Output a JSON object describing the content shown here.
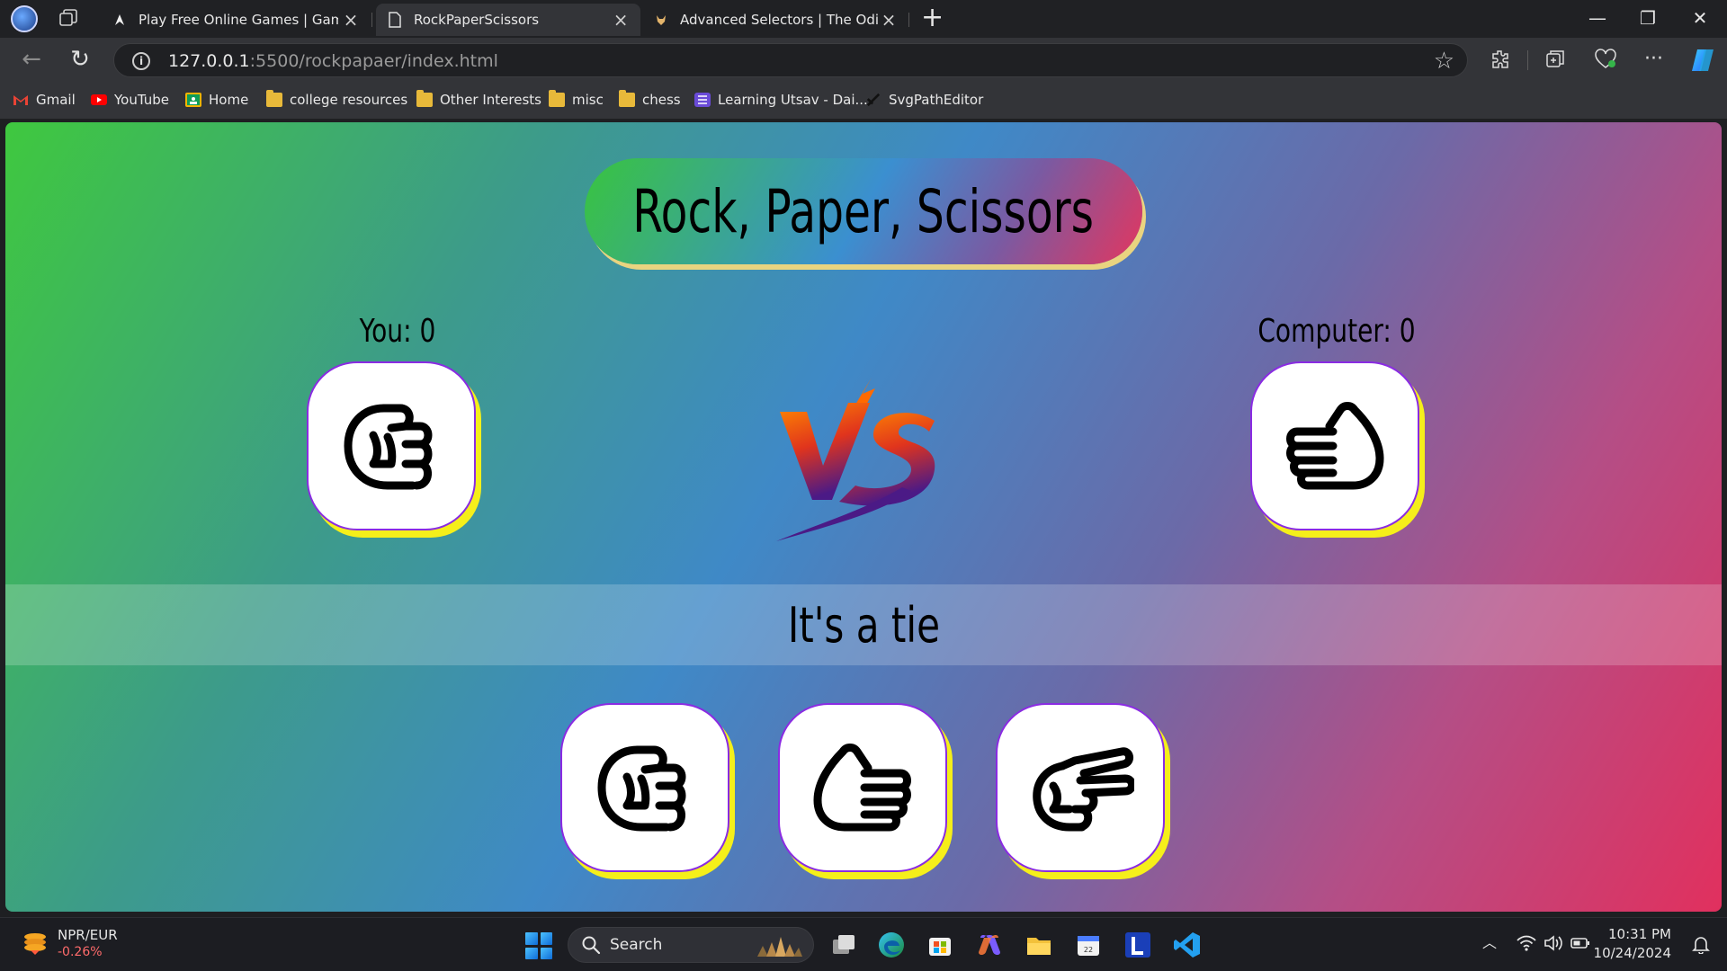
{
  "browser": {
    "tabs": [
      {
        "title": "Play Free Online Games | Games f",
        "active": false
      },
      {
        "title": "RockPaperScissors",
        "active": true
      },
      {
        "title": "Advanced Selectors | The Odin Pr",
        "active": false
      }
    ],
    "address": {
      "host": "127.0.0.1",
      "path": ":5500/rockpapaer/index.html"
    },
    "bookmarks": [
      "Gmail",
      "YouTube",
      "Home",
      "college resources",
      "Other Interests",
      "misc",
      "chess",
      "Learning Utsav - Dai...",
      "SvgPathEditor"
    ]
  },
  "game": {
    "title": "Rock, Paper, Scissors",
    "player_score_label": "You: 0",
    "computer_score_label": "Computer: 0",
    "player_choice_icon": "rock-fist-icon",
    "computer_choice_icon": "paper-hand-icon",
    "vs_label": "VS",
    "result": "It's a tie",
    "choices": [
      {
        "name": "rock",
        "icon": "rock-fist-icon"
      },
      {
        "name": "paper",
        "icon": "paper-hand-icon"
      },
      {
        "name": "scissors",
        "icon": "scissors-hand-icon"
      }
    ],
    "colors": {
      "card_border": "#8a2be2",
      "card_shadow": "#f5ef1a",
      "title_shadow": "#e9d480"
    }
  },
  "taskbar": {
    "widget_title": "NPR/EUR",
    "widget_value": "-0.26%",
    "search_label": "Search",
    "time": "10:31 PM",
    "date": "10/24/2024"
  }
}
